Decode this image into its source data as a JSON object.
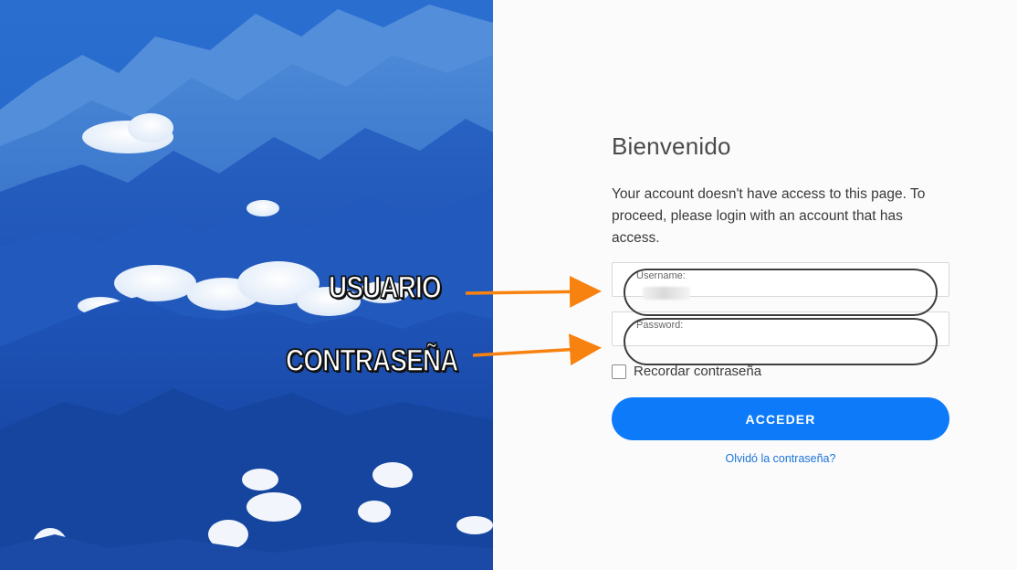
{
  "login": {
    "title": "Bienvenido",
    "message": "Your account doesn't have access to this page. To proceed, please login with an account that has access.",
    "username": {
      "label": "Username:",
      "value": ""
    },
    "password": {
      "label": "Password:",
      "value": ""
    },
    "remember_label": "Recordar contraseña",
    "remember_checked": false,
    "submit_label": "ACCEDER",
    "forgot_label": "Olvidó la contraseña?"
  },
  "annotations": {
    "username_callout": "USUARIO",
    "password_callout": "CONTRASEÑA",
    "arrow_color": "#f7820f",
    "highlight_color": "#444444"
  },
  "colors": {
    "primary_button": "#0d7bf9",
    "link": "#1a74d9",
    "sky": "#1a56c4"
  }
}
